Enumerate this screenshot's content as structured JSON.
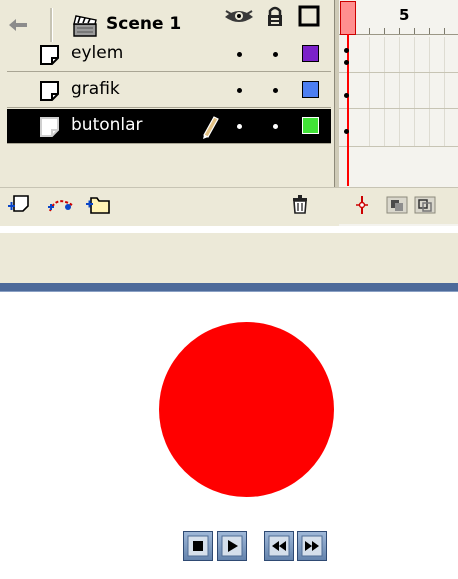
{
  "timeline": {
    "header_icons": [
      "eye-icon",
      "lock-icon",
      "outline-icon"
    ],
    "ruler_label": "5",
    "layers": [
      {
        "name": "eylem",
        "color": "#7b22c9",
        "selected": false
      },
      {
        "name": "grafik",
        "color": "#4d7ff2",
        "selected": false
      },
      {
        "name": "butonlar",
        "color": "#41e337",
        "selected": true
      }
    ]
  },
  "edit_bar": {
    "scene_label": "Scene 1"
  },
  "stage": {
    "circle_color": "#ff0000",
    "controls": [
      "stop",
      "play",
      "rewind",
      "fast-forward"
    ]
  },
  "colors": {
    "panel_bg": "#ece9d8",
    "selected_row": "#000000",
    "playhead": "#ff0000",
    "stage_divider": "#4d6a9a"
  }
}
